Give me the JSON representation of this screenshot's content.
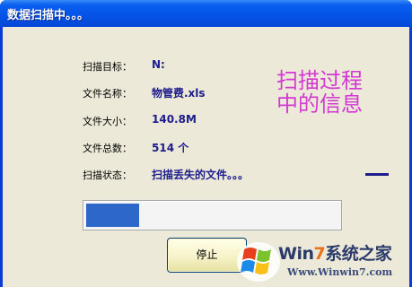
{
  "window": {
    "title": "数据扫描中。。。"
  },
  "fields": [
    {
      "label": "扫描目标：",
      "value": "N:"
    },
    {
      "label": "文件名称：",
      "value": "物管费.xls"
    },
    {
      "label": "文件大小：",
      "value": "140.8M"
    },
    {
      "label": "文件总数：",
      "value": "514 个"
    },
    {
      "label": "扫描状态：",
      "value": "扫描丢失的文件。。。"
    }
  ],
  "annotation": {
    "line1": "扫描过程",
    "line2": "中的信息",
    "color": "#d23ad2"
  },
  "progress": {
    "fraction": 0.21
  },
  "stop_button": {
    "label": "停止"
  },
  "watermark": {
    "brand_prefix": "Win",
    "brand_digit": "7",
    "brand_suffix": "系统之家",
    "url": "Www.Winwin7.com",
    "icon": "windows-flag-icon"
  },
  "colors": {
    "titlebar": "#0453e6",
    "client_bg": "#ece9d8",
    "value_text": "#1c1c8c",
    "progress_fill": "#2d68c8"
  }
}
